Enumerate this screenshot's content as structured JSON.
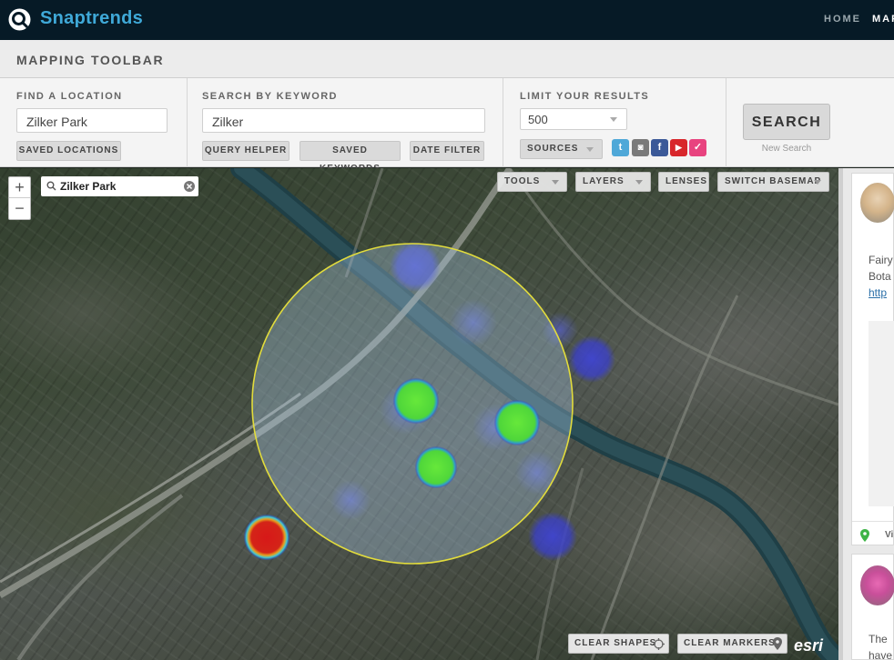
{
  "app": {
    "brand": "Snaptrends",
    "nav": [
      {
        "label": "HOME"
      },
      {
        "label": "MAP"
      }
    ]
  },
  "toolbar": {
    "title": "MAPPING TOOLBAR",
    "find_location": {
      "label": "FIND A LOCATION",
      "value": "Zilker Park",
      "saved_btn": "SAVED LOCATIONS"
    },
    "keyword": {
      "label": "SEARCH BY KEYWORD",
      "value": "Zilker",
      "buttons": [
        "QUERY HELPER",
        "SAVED KEYWORDS",
        "DATE FILTER"
      ]
    },
    "limit": {
      "label": "LIMIT YOUR RESULTS",
      "count": "500",
      "sources": "SOURCES",
      "social_icons": [
        {
          "name": "twitter",
          "glyph": "t",
          "color": "#4fa8d8"
        },
        {
          "name": "instagram",
          "glyph": "◙",
          "color": "#7a7a7a"
        },
        {
          "name": "facebook",
          "glyph": "f",
          "color": "#3b5998"
        },
        {
          "name": "youtube",
          "glyph": "▶",
          "color": "#d8262b"
        },
        {
          "name": "foursquare",
          "glyph": "✓",
          "color": "#e8437f"
        }
      ]
    },
    "search_btn": "SEARCH",
    "new_search": "New Search"
  },
  "map": {
    "search_value": "Zilker Park",
    "controls": [
      "TOOLS",
      "LAYERS",
      "LENSES",
      "SWITCH BASEMAP"
    ],
    "clear_shapes": "CLEAR SHAPES",
    "clear_markers": "CLEAR MARKERS",
    "attribution": "esri"
  },
  "feed": {
    "card1_lines": [
      "Fairy",
      "Bota",
      "http"
    ],
    "card1_footer": "Vi",
    "card2_lines": [
      "The",
      "have"
    ]
  }
}
